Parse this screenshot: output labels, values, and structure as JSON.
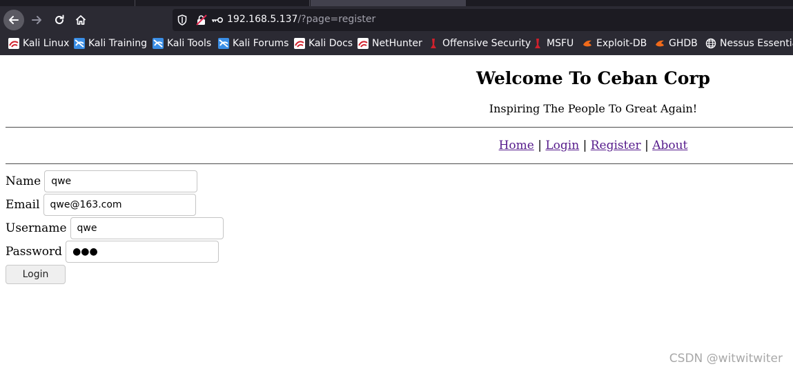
{
  "browser": {
    "url_host": "192.168.5.137",
    "url_path": "/?page=register"
  },
  "bookmarks": [
    {
      "label": "Kali Linux",
      "icon": "kali-red-icon"
    },
    {
      "label": "Kali Training",
      "icon": "kali-blue-icon"
    },
    {
      "label": "Kali Tools",
      "icon": "kali-blue-icon"
    },
    {
      "label": "Kali Forums",
      "icon": "kali-blue-icon"
    },
    {
      "label": "Kali Docs",
      "icon": "kali-red-icon"
    },
    {
      "label": "NetHunter",
      "icon": "kali-red-icon"
    },
    {
      "label": "Offensive Security",
      "icon": "offsec-icon"
    },
    {
      "label": "MSFU",
      "icon": "offsec-icon"
    },
    {
      "label": "Exploit-DB",
      "icon": "exploitdb-icon"
    },
    {
      "label": "GHDB",
      "icon": "exploitdb-icon"
    },
    {
      "label": "Nessus Essentia",
      "icon": "globe-icon"
    }
  ],
  "page": {
    "title": "Welcome To Ceban Corp",
    "subtitle": "Inspiring The People To Great Again!",
    "nav": {
      "home": "Home",
      "login": "Login",
      "register": "Register",
      "about": "About",
      "separator": "|"
    },
    "form": {
      "name_label": "Name",
      "name_value": "qwe",
      "email_label": "Email",
      "email_value": "qwe@163.com",
      "username_label": "Username",
      "username_value": "qwe",
      "password_label": "Password",
      "password_value": "●●●",
      "submit_label": "Login"
    }
  },
  "watermark": "CSDN @witwitwiter",
  "colors": {
    "chrome_bg": "#2b2a33",
    "urlbar_bg": "#1c1b22",
    "link": "#551a8b"
  }
}
